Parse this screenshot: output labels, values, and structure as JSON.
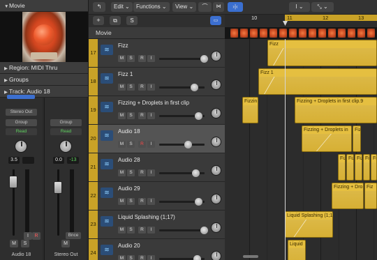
{
  "inspector": {
    "movie_header": "Movie",
    "region_header": "Region: MIDI Thru",
    "groups_header": "Groups",
    "track_header": "Track: Audio 18",
    "strip1": {
      "output": "Stereo Out",
      "group": "Group",
      "read": "Read",
      "value_left": "3.5",
      "name": "Audio 18",
      "m": "M",
      "s": "S",
      "i": "I",
      "r": "R"
    },
    "strip2": {
      "group": "Group",
      "read": "Read",
      "value_left": "0.0",
      "value_right": "-13",
      "bounce": "Bnce",
      "name": "Stereo Out",
      "m": "M"
    }
  },
  "toolbar": {
    "edit": "Edit",
    "functions": "Functions",
    "view": "View"
  },
  "track_list": {
    "movie_row": "Movie",
    "add": "+",
    "solo": "S",
    "tracks": [
      {
        "num": "17",
        "name": "Fizz"
      },
      {
        "num": "18",
        "name": "Fizz 1"
      },
      {
        "num": "19",
        "name": "Fizzing + Droplets in first clip"
      },
      {
        "num": "20",
        "name": "Audio 18"
      },
      {
        "num": "21",
        "name": "Audio 28"
      },
      {
        "num": "22",
        "name": "Audio 29"
      },
      {
        "num": "23",
        "name": "Liquid Splashing (1;17)"
      },
      {
        "num": "24",
        "name": "Audio 20"
      }
    ],
    "btn_m": "M",
    "btn_s": "S",
    "btn_r": "R",
    "btn_i": "I"
  },
  "ruler": {
    "n10": "10",
    "n11": "11",
    "n12": "12",
    "n13": "13"
  },
  "regions": {
    "fizz": "Fizz",
    "fizz1": "Fizz 1",
    "fizzing_a": "Fizzin",
    "fizzing_b": "Fizzing + Droplets in first clip.9",
    "audio18_a": "Fizzing + Droplets in",
    "audio18_b": "Fiz",
    "audio28_a": "Fiz",
    "audio28_b": "Fiz",
    "audio28_c": "Fiz",
    "audio28_d": "Fiz",
    "audio28_e": "Fiz",
    "audio29_a": "Fizzing + Dro",
    "audio29_b": "Fiz",
    "liquid": "Liquid Splashing (1;1",
    "liquid2": "Liquid"
  },
  "colors": {
    "region": "#d4ac2c",
    "track_number": "#c9a227",
    "selected_track": "#545454"
  }
}
